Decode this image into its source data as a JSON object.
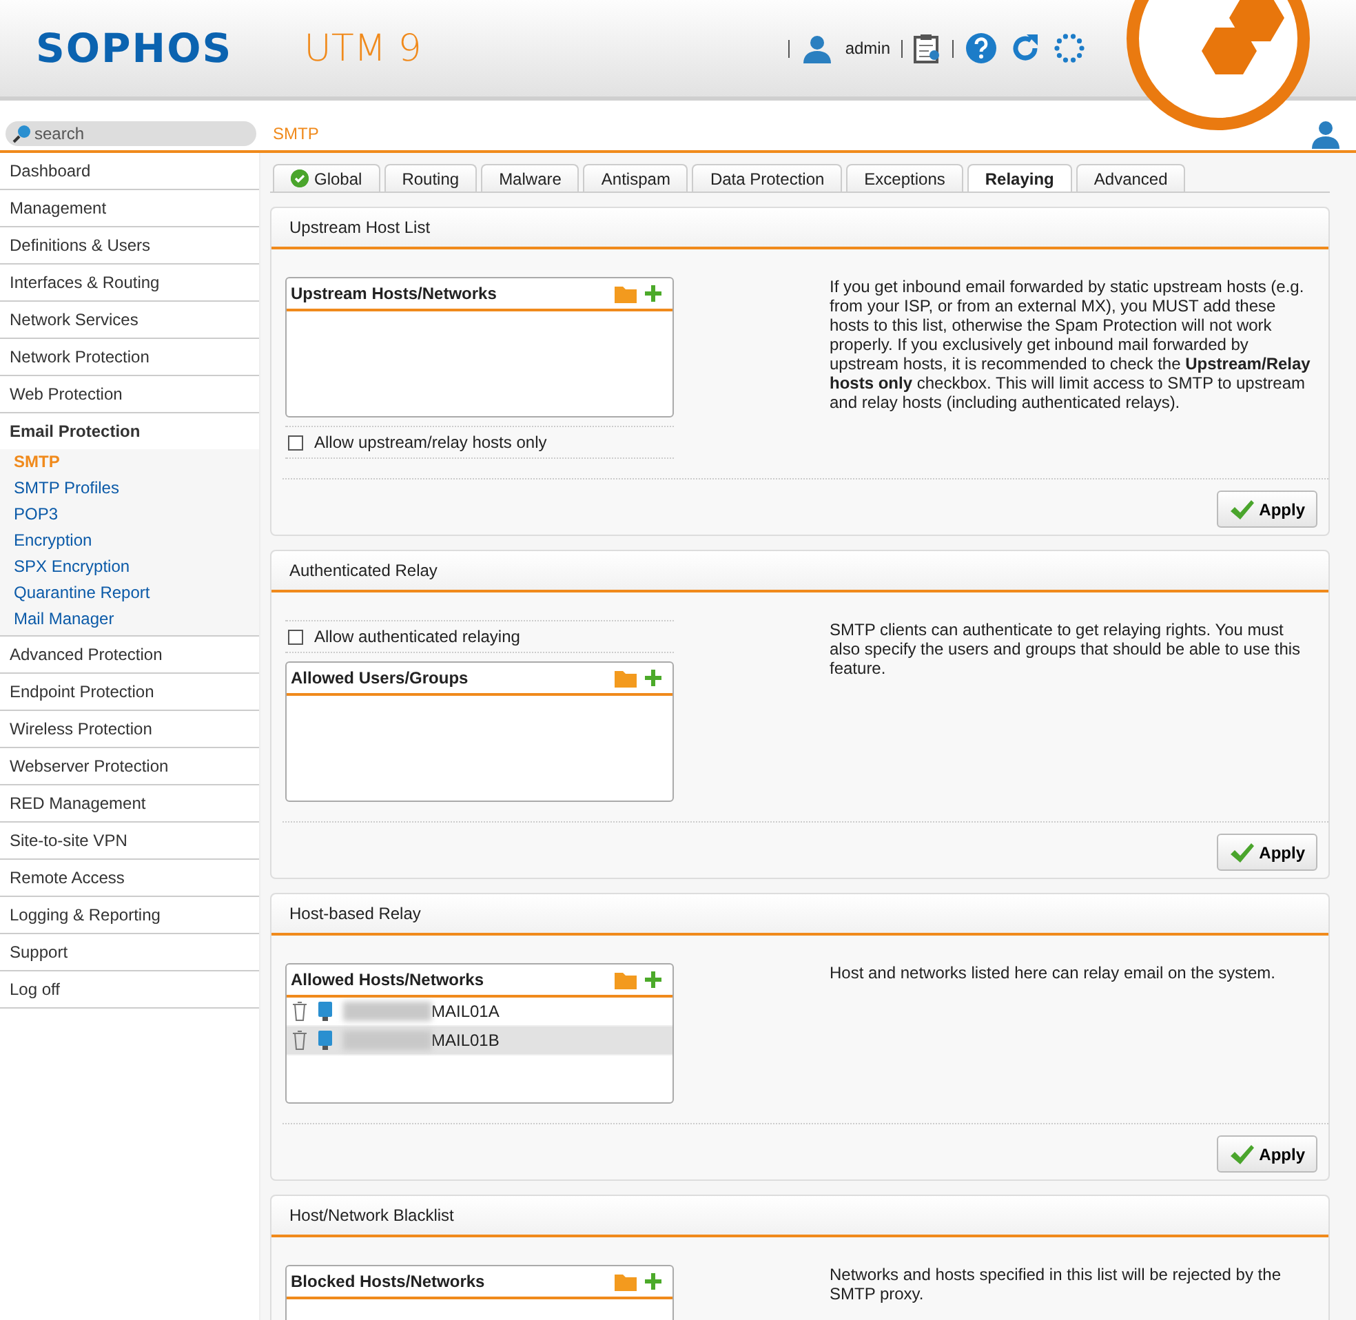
{
  "header": {
    "brand": "SOPHOS",
    "product": "UTM 9",
    "user": "admin"
  },
  "search": {
    "placeholder": "search"
  },
  "breadcrumb": "SMTP",
  "sidebar": {
    "items": [
      {
        "label": "Dashboard",
        "expanded": false
      },
      {
        "label": "Management",
        "expanded": false
      },
      {
        "label": "Definitions & Users",
        "expanded": false
      },
      {
        "label": "Interfaces & Routing",
        "expanded": false
      },
      {
        "label": "Network Services",
        "expanded": false
      },
      {
        "label": "Network Protection",
        "expanded": false
      },
      {
        "label": "Web Protection",
        "expanded": false
      },
      {
        "label": "Email Protection",
        "expanded": true,
        "children": [
          {
            "label": "SMTP",
            "selected": true
          },
          {
            "label": "SMTP Profiles",
            "selected": false
          },
          {
            "label": "POP3",
            "selected": false
          },
          {
            "label": "Encryption",
            "selected": false
          },
          {
            "label": "SPX Encryption",
            "selected": false
          },
          {
            "label": "Quarantine Report",
            "selected": false
          },
          {
            "label": "Mail Manager",
            "selected": false
          }
        ]
      },
      {
        "label": "Advanced Protection",
        "expanded": false
      },
      {
        "label": "Endpoint Protection",
        "expanded": false
      },
      {
        "label": "Wireless Protection",
        "expanded": false
      },
      {
        "label": "Webserver Protection",
        "expanded": false
      },
      {
        "label": "RED Management",
        "expanded": false
      },
      {
        "label": "Site-to-site VPN",
        "expanded": false
      },
      {
        "label": "Remote Access",
        "expanded": false
      },
      {
        "label": "Logging & Reporting",
        "expanded": false
      },
      {
        "label": "Support",
        "expanded": false
      },
      {
        "label": "Log off",
        "expanded": false
      }
    ]
  },
  "tabs": [
    {
      "label": "Global",
      "selected": false,
      "status_ok": true
    },
    {
      "label": "Routing",
      "selected": false,
      "status_ok": false
    },
    {
      "label": "Malware",
      "selected": false,
      "status_ok": false
    },
    {
      "label": "Antispam",
      "selected": false,
      "status_ok": false
    },
    {
      "label": "Data Protection",
      "selected": false,
      "status_ok": false
    },
    {
      "label": "Exceptions",
      "selected": false,
      "status_ok": false
    },
    {
      "label": "Relaying",
      "selected": true,
      "status_ok": false
    },
    {
      "label": "Advanced",
      "selected": false,
      "status_ok": false
    }
  ],
  "sections": [
    {
      "title": "Upstream Host List",
      "controls": [
        {
          "kind": "list",
          "title": "Upstream Hosts/Networks"
        },
        {
          "kind": "checkbox",
          "label": "Allow upstream/relay hosts only",
          "checked": false
        }
      ],
      "help": "If you get inbound email forwarded by static upstream hosts (e.g. from your ISP, or from an external MX), you MUST add these hosts to this list, otherwise the Spam Protection will not work properly. If you exclusively get inbound mail forwarded by upstream hosts, it is recommended to check the **Upstream/Relay hosts only** checkbox. This will limit access to SMTP to upstream and relay hosts (including authenticated relays).",
      "button": "Apply"
    },
    {
      "title": "Authenticated Relay",
      "controls": [
        {
          "kind": "checkbox",
          "label": "Allow authenticated relaying",
          "checked": false
        },
        {
          "kind": "list",
          "title": "Allowed Users/Groups"
        }
      ],
      "help": "SMTP clients can authenticate to get relaying rights. You must also specify the users and groups that should be able to use this feature.",
      "button": "Apply"
    },
    {
      "title": "Host-based Relay",
      "controls": [
        {
          "kind": "list",
          "title": "Allowed Hosts/Networks",
          "rows": [
            {
              "name": "MAIL01A",
              "selected": false
            },
            {
              "name": "MAIL01B",
              "selected": true
            }
          ]
        }
      ],
      "help": "Host and networks listed here can relay email on the system.",
      "button": "Apply"
    },
    {
      "title": "Host/Network Blacklist",
      "controls": [
        {
          "kind": "list",
          "title": "Blocked Hosts/Networks"
        }
      ],
      "help": "Networks and hosts specified in this list will be rejected by the SMTP proxy."
    }
  ]
}
